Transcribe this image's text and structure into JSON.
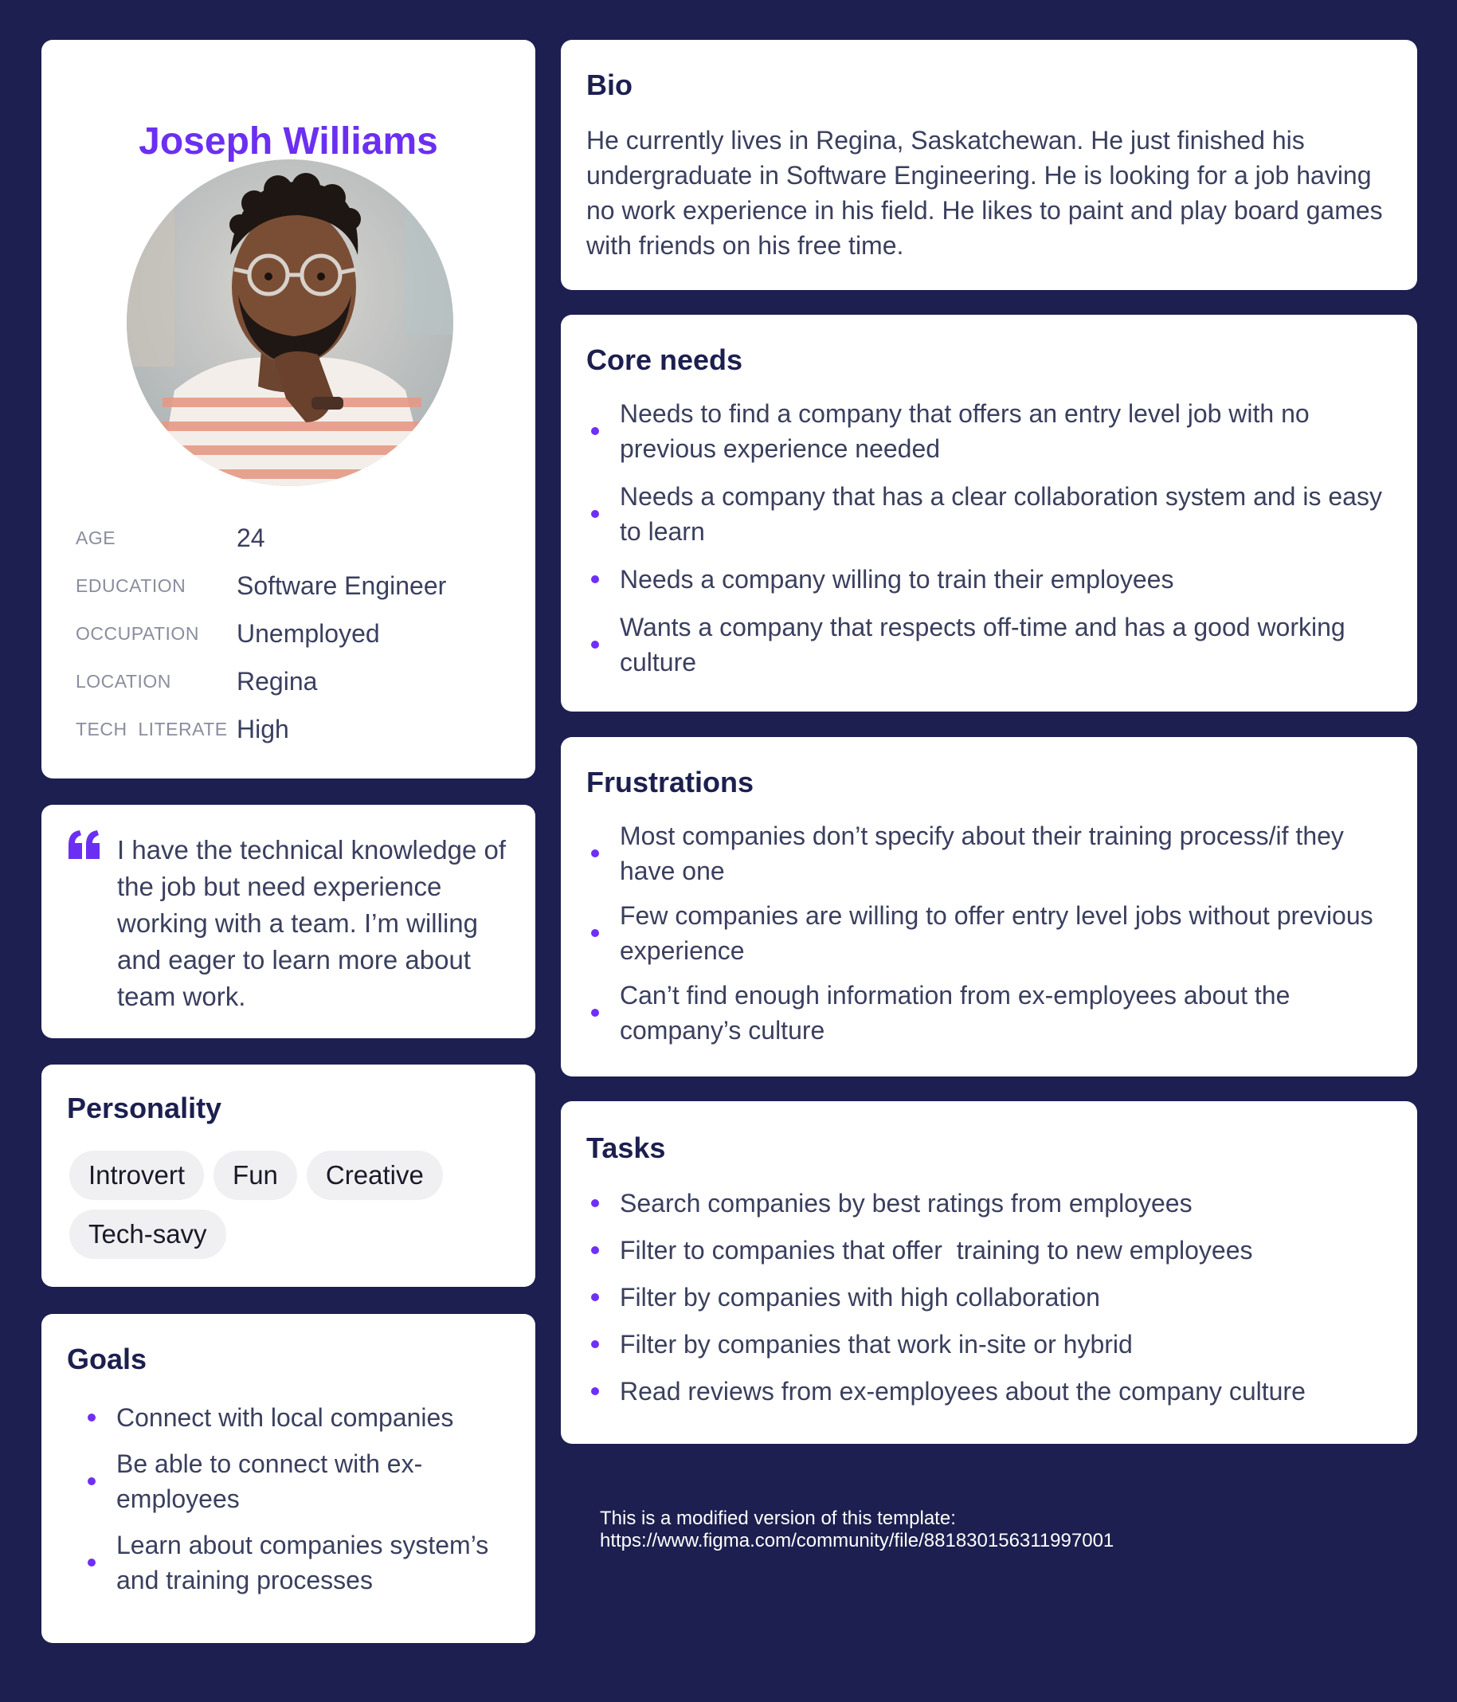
{
  "profile": {
    "name": "Joseph Williams",
    "facts": [
      {
        "label": "AGE",
        "value": "24"
      },
      {
        "label": "EDUCATION",
        "value": "Software Engineer"
      },
      {
        "label": "OCCUPATION",
        "value": "Unemployed"
      },
      {
        "label": "LOCATION",
        "value": "Regina"
      },
      {
        "label": "TECH  LITERATE",
        "value": "High"
      }
    ]
  },
  "quote": {
    "text": "I have the technical knowledge of the job but need experience working with a team. I’m willing and eager to learn more about team work."
  },
  "personality": {
    "title": "Personality",
    "traits": [
      "Introvert",
      "Fun",
      "Creative",
      "Tech-savy"
    ]
  },
  "goals": {
    "title": "Goals",
    "items": [
      "Connect with local companies",
      "Be able to connect with ex-employees",
      "Learn about companies system’s and training processes"
    ]
  },
  "bio": {
    "title": "Bio",
    "text": "He currently lives in Regina, Saskatchewan. He just finished his undergraduate in Software Engineering. He is looking for a job having no work experience in his field. He likes to paint and play board games with friends on his free time."
  },
  "core_needs": {
    "title": "Core needs",
    "items": [
      "Needs to find a company that offers an entry level job with no previous experience needed",
      "Needs a company that has a clear collaboration system and is easy to learn",
      "Needs a company willing to train their employees",
      "Wants a company that respects off-time and has a good working culture"
    ]
  },
  "frustrations": {
    "title": "Frustrations",
    "items": [
      "Most companies don’t specify about their training process/if they have one",
      "Few companies are willing to offer entry level jobs without previous experience",
      "Can’t find enough information from ex-employees about the company’s culture"
    ]
  },
  "tasks": {
    "title": "Tasks",
    "items": [
      "Search companies by best ratings from employees",
      "Filter to companies that offer  training to new employees",
      "Filter by companies with high collaboration",
      "Filter by companies that work in-site or hybrid",
      "Read reviews from ex-employees about the company culture"
    ]
  },
  "footnote": "This is a modified version of this template: https://www.figma.com/community/file/881830156311997001",
  "colors": {
    "background": "#1c1f4f",
    "accent": "#6b2ff2",
    "heading": "#1c1f4f",
    "body_text": "#3a3f5e",
    "chip": "#f0f0f2"
  },
  "icons": {
    "quote": "quote-mark-icon",
    "bullet": "bullet-dot-icon"
  }
}
